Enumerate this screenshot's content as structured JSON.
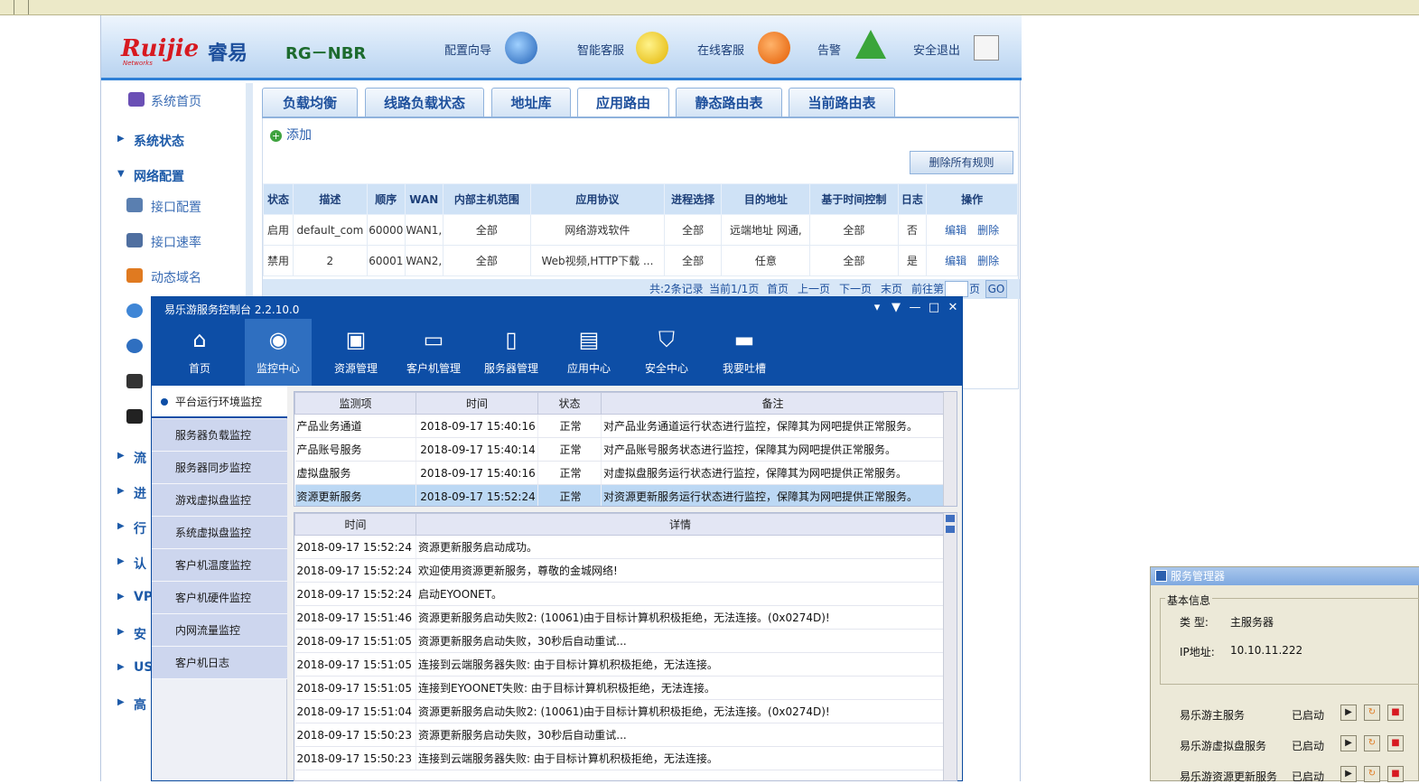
{
  "router": {
    "logo": "Ruijie",
    "logo_sub": "Networks",
    "logo_cn": "睿易",
    "model": "RG－NBR",
    "header_items": [
      "配置向导",
      "智能客服",
      "在线客服",
      "告警",
      "安全退出"
    ],
    "sidebar": {
      "home": "系统首页",
      "status": "系统状态",
      "netcfg": "网络配置",
      "iface": "接口配置",
      "rate": "接口速率",
      "ddns": "动态域名",
      "partial": [
        "流",
        "进",
        "行",
        "认",
        "VP",
        "安",
        "US",
        "高"
      ]
    },
    "tabs": [
      "负载均衡",
      "线路负载状态",
      "地址库",
      "应用路由",
      "静态路由表",
      "当前路由表"
    ],
    "add_label": "添加",
    "delete_all": "删除所有规则",
    "table": {
      "headers": [
        "状态",
        "描述",
        "顺序",
        "WAN",
        "内部主机范围",
        "应用协议",
        "进程选择",
        "目的地址",
        "基于时间控制",
        "日志",
        "操作"
      ],
      "rows": [
        {
          "status": "启用",
          "desc": "default_com",
          "order": "60000",
          "wan": "WAN1,",
          "host": "全部",
          "proto": "网络游戏软件",
          "proc": "全部",
          "dest": "远端地址 网通,",
          "time": "全部",
          "log": "否",
          "edit": "编辑",
          "del": "删除"
        },
        {
          "status": "禁用",
          "desc": "2",
          "order": "60001",
          "wan": "WAN2,",
          "host": "全部",
          "proto": "Web视频,HTTP下载 ...",
          "proc": "全部",
          "dest": "任意",
          "time": "全部",
          "log": "是",
          "edit": "编辑",
          "del": "删除"
        }
      ]
    },
    "pager": {
      "total": "共:2条记录",
      "current": "当前1/1页",
      "first": "首页",
      "prev": "上一页",
      "next": "下一页",
      "last": "末页",
      "goto": "前往第",
      "page": "页",
      "go": "GO"
    }
  },
  "console": {
    "title": "易乐游服务控制台 2.2.10.0",
    "nav": [
      {
        "label": "首页",
        "icon": "home-icon",
        "glyph": "⌂"
      },
      {
        "label": "监控中心",
        "icon": "eye-icon",
        "glyph": "◉"
      },
      {
        "label": "资源管理",
        "icon": "gamepad-icon",
        "glyph": "▣"
      },
      {
        "label": "客户机管理",
        "icon": "monitor-icon",
        "glyph": "▭"
      },
      {
        "label": "服务器管理",
        "icon": "server-icon",
        "glyph": "▯"
      },
      {
        "label": "应用中心",
        "icon": "toolbox-icon",
        "glyph": "▤"
      },
      {
        "label": "安全中心",
        "icon": "shield-icon",
        "glyph": "⛉"
      },
      {
        "label": "我要吐槽",
        "icon": "speech-icon",
        "glyph": "▬"
      }
    ],
    "side": [
      "平台运行环境监控",
      "服务器负载监控",
      "服务器同步监控",
      "游戏虚拟盘监控",
      "系统虚拟盘监控",
      "客户机温度监控",
      "客户机硬件监控",
      "内网流量监控",
      "客户机日志"
    ],
    "monitor": {
      "headers": [
        "监测项",
        "时间",
        "状态",
        "备注"
      ],
      "rows": [
        [
          "产品业务通道",
          "2018-09-17 15:40:16",
          "正常",
          "对产品业务通道运行状态进行监控，保障其为网吧提供正常服务。"
        ],
        [
          "产品账号服务",
          "2018-09-17 15:40:14",
          "正常",
          "对产品账号服务状态进行监控，保障其为网吧提供正常服务。"
        ],
        [
          "虚拟盘服务",
          "2018-09-17 15:40:16",
          "正常",
          "对虚拟盘服务运行状态进行监控，保障其为网吧提供正常服务。"
        ],
        [
          "资源更新服务",
          "2018-09-17 15:52:24",
          "正常",
          "对资源更新服务运行状态进行监控，保障其为网吧提供正常服务。"
        ]
      ]
    },
    "log": {
      "headers": [
        "时间",
        "详情"
      ],
      "rows": [
        [
          "2018-09-17 15:52:24",
          "资源更新服务启动成功。"
        ],
        [
          "2018-09-17 15:52:24",
          "欢迎使用资源更新服务，尊敬的金城网络!"
        ],
        [
          "2018-09-17 15:52:24",
          "启动EYOONET。"
        ],
        [
          "2018-09-17 15:51:46",
          "资源更新服务启动失败2: (10061)由于目标计算机积极拒绝，无法连接。(0x0274D)!"
        ],
        [
          "2018-09-17 15:51:05",
          "资源更新服务启动失败，30秒后自动重试..."
        ],
        [
          "2018-09-17 15:51:05",
          "连接到云端服务器失败: 由于目标计算机积极拒绝，无法连接。"
        ],
        [
          "2018-09-17 15:51:05",
          "连接到EYOONET失败: 由于目标计算机积极拒绝，无法连接。"
        ],
        [
          "2018-09-17 15:51:04",
          "资源更新服务启动失败2: (10061)由于目标计算机积极拒绝，无法连接。(0x0274D)!"
        ],
        [
          "2018-09-17 15:50:23",
          "资源更新服务启动失败，30秒后自动重试..."
        ],
        [
          "2018-09-17 15:50:23",
          "连接到云端服务器失败: 由于目标计算机积极拒绝，无法连接。"
        ]
      ]
    }
  },
  "svcmgr": {
    "title": "服务管理器",
    "group": "基本信息",
    "type_label": "类 型:",
    "type_value": "主服务器",
    "ip_label": "IP地址:",
    "ip_value": "10.10.11.222",
    "services": [
      {
        "name": "易乐游主服务",
        "state": "已启动"
      },
      {
        "name": "易乐游虚拟盘服务",
        "state": "已启动"
      },
      {
        "name": "易乐游资源更新服务",
        "state": "已启动"
      }
    ]
  },
  "colors": {
    "console_blue": "#0d4ea6",
    "router_accent": "#2e7fd6",
    "selection": "#bcd8f4"
  }
}
